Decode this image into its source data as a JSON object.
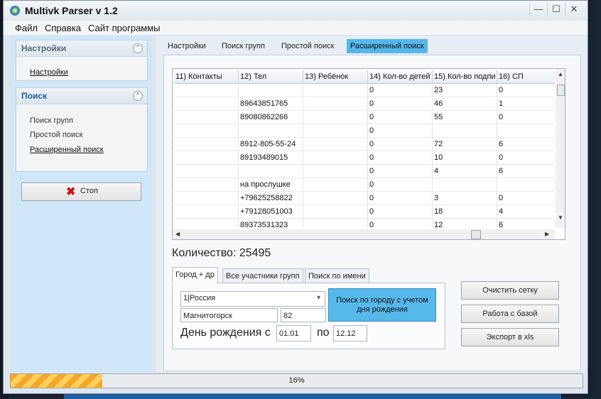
{
  "window": {
    "title": "Multivk Parser v 1.2",
    "icon": "app-icon",
    "controls": {
      "minimize": "—",
      "maximize": "☐",
      "close": "✕"
    }
  },
  "menu": [
    "Файл",
    "Справка",
    "Сайт программы"
  ],
  "sidebar": {
    "settings_panel": {
      "title": "Настройки",
      "items": [
        "Настройки"
      ]
    },
    "search_panel": {
      "title": "Поиск",
      "items": [
        "Поиск групп",
        "Простой поиск",
        "Расширенный поиск"
      ]
    },
    "stop_label": "Стоп"
  },
  "tabs": [
    "Настройки",
    "Поиск групп",
    "Простой поиск",
    "Расширенный поиск"
  ],
  "active_tab": "Расширенный поиск",
  "grid": {
    "columns": [
      "11) Контакты",
      "12) Тел",
      "13) Ребёнок",
      "14) Кол-во детей",
      "15) Кол-во подпи",
      "16) СП"
    ],
    "rows": [
      [
        "",
        "",
        "",
        "0",
        "23",
        "0"
      ],
      [
        "",
        "89643851765",
        "",
        "0",
        "46",
        "1"
      ],
      [
        "",
        "89080862266",
        "",
        "0",
        "55",
        "0"
      ],
      [
        "",
        "",
        "",
        "0",
        "",
        ""
      ],
      [
        "",
        "8912-805-55-24",
        "",
        "0",
        "72",
        "6"
      ],
      [
        "",
        "89193489015",
        "",
        "0",
        "10",
        "0"
      ],
      [
        "",
        "",
        "",
        "0",
        "4",
        "6"
      ],
      [
        "",
        "на прослушке",
        "",
        "0",
        "",
        ""
      ],
      [
        "",
        "+79625258822",
        "",
        "0",
        "3",
        "0"
      ],
      [
        "",
        "+79128051003",
        "",
        "0",
        "18",
        "4"
      ],
      [
        "",
        "89373531323",
        "",
        "0",
        "12",
        "6"
      ]
    ]
  },
  "count": "Количество: 25495",
  "subtabs": [
    "Город + др",
    "Все участники групп",
    "Поиск по имени"
  ],
  "form": {
    "country": "1|Россия",
    "city": "Магнитогорск",
    "city_id": "82",
    "search_button": "Поиск по городу с учетом дня рождения",
    "birthday_label": "День рождения с",
    "from": "01.01",
    "to_label": "по",
    "to": "12.12"
  },
  "actions": [
    "Очистить сетку",
    "Работа с базой",
    "Экспорт в xls"
  ],
  "progress": {
    "value": 0.16,
    "text": "16%",
    "colors": {
      "fill": "#f6a623",
      "stripe": "#ffd15c"
    }
  }
}
